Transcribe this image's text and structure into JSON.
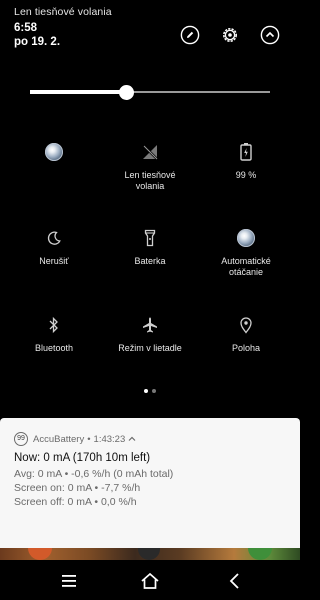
{
  "status": {
    "carrier_text": "Len tiesňové volania"
  },
  "header": {
    "time": "6:58",
    "date": "po 19. 2.",
    "buttons": [
      {
        "name": "edit",
        "icon": "pencil-icon"
      },
      {
        "name": "settings",
        "icon": "gear-icon"
      },
      {
        "name": "collapse",
        "icon": "chevron-up-icon"
      }
    ]
  },
  "brightness": {
    "level": 0.4
  },
  "tiles": [
    {
      "id": "wifi",
      "label": "",
      "icon": "wifi-ball-icon",
      "active": true
    },
    {
      "id": "cellular",
      "label": "Len tiesňové\nvolania",
      "icon": "no-signal-icon",
      "active": false
    },
    {
      "id": "battery",
      "label": "99 %",
      "icon": "battery-icon",
      "active": false
    },
    {
      "id": "dnd",
      "label": "Nerušiť",
      "icon": "moon-icon",
      "active": false
    },
    {
      "id": "flashlight",
      "label": "Baterka",
      "icon": "flashlight-icon",
      "active": false
    },
    {
      "id": "autorotate",
      "label": "Automatické\notáčanie",
      "icon": "rotate-ball-icon",
      "active": true
    },
    {
      "id": "bluetooth",
      "label": "Bluetooth",
      "icon": "bluetooth-icon",
      "active": false
    },
    {
      "id": "airplane",
      "label": "Režim v lietadle",
      "icon": "airplane-icon",
      "active": false
    },
    {
      "id": "location",
      "label": "Poloha",
      "icon": "location-pin-icon",
      "active": false
    }
  ],
  "pagination": {
    "pages": 2,
    "current": 1
  },
  "notification": {
    "app_badge": "99",
    "app_name": "AccuBattery",
    "separator": "•",
    "time": "1:43:23",
    "now": "Now: 0 mA (170h 10m left)",
    "lines": [
      "Avg: 0 mA • -0,6 %/h (0 mAh total)",
      "Screen on: 0 mA • -7,7 %/h",
      "Screen off: 0 mA • 0,0 %/h"
    ]
  },
  "navbar": {
    "buttons": [
      "menu",
      "home",
      "back"
    ]
  },
  "colors": {
    "panel_bg": "#000000",
    "notification_bg": "#f7f7f7",
    "text_muted": "#6b6b6b"
  }
}
